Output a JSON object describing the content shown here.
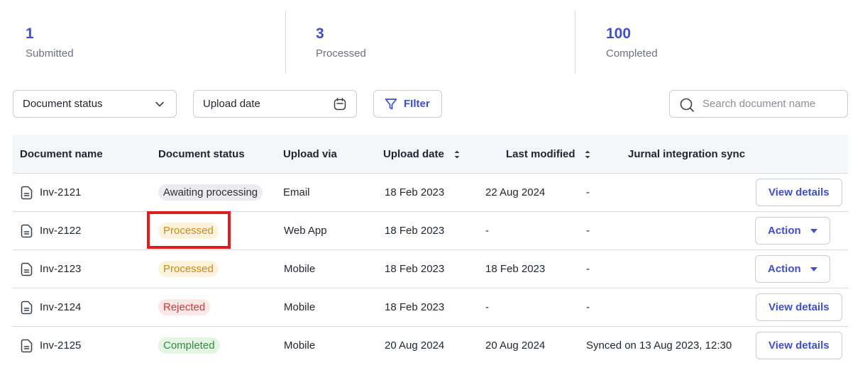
{
  "stats": [
    {
      "value": "1",
      "label": "Submitted"
    },
    {
      "value": "3",
      "label": "Processed"
    },
    {
      "value": "100",
      "label": "Completed"
    }
  ],
  "toolbar": {
    "status_select": {
      "value": "Document status",
      "icon": "chevron-down-icon"
    },
    "date_picker": {
      "value": "Upload date",
      "icon": "calendar-icon"
    },
    "filter_button": {
      "label": "FIlter",
      "icon": "filter-icon"
    },
    "search": {
      "placeholder": "Search document name",
      "icon": "search-icon"
    }
  },
  "table": {
    "headers": [
      "Document name",
      "Document status",
      "Upload via",
      "Upload date",
      "Last modified",
      "Jurnal integration sync"
    ],
    "sortable": [
      "Upload date",
      "Last modified"
    ],
    "rows": [
      {
        "name": "Inv-2121",
        "status": "Awaiting processing",
        "via": "Email",
        "upload": "18 Feb 2023",
        "modified": "22 Aug 2024",
        "sync": "-",
        "action": "View details"
      },
      {
        "name": "Inv-2122",
        "status": "Processed",
        "via": "Web App",
        "upload": "18 Feb 2023",
        "modified": "-",
        "sync": "-",
        "action": "Action"
      },
      {
        "name": "Inv-2123",
        "status": "Processed",
        "via": "Mobile",
        "upload": "18 Feb 2023",
        "modified": "18 Feb 2023",
        "sync": "-",
        "action": "Action"
      },
      {
        "name": "Inv-2124",
        "status": "Rejected",
        "via": "Mobile",
        "upload": "18 Feb 2023",
        "modified": "-",
        "sync": "-",
        "action": "View details"
      },
      {
        "name": "Inv-2125",
        "status": "Completed",
        "via": "Mobile",
        "upload": "20 Aug 2024",
        "modified": "20 Aug 2024",
        "sync": "Synced on 13 Aug 2023, 12:30",
        "action": "View details"
      }
    ]
  },
  "colors": {
    "accent": "#3f4ec9",
    "awaiting": "#ececef",
    "processed": "#c98a12",
    "rejected": "#c03a3a",
    "completed": "#2f8f3a",
    "highlight": "#e01c1c"
  }
}
